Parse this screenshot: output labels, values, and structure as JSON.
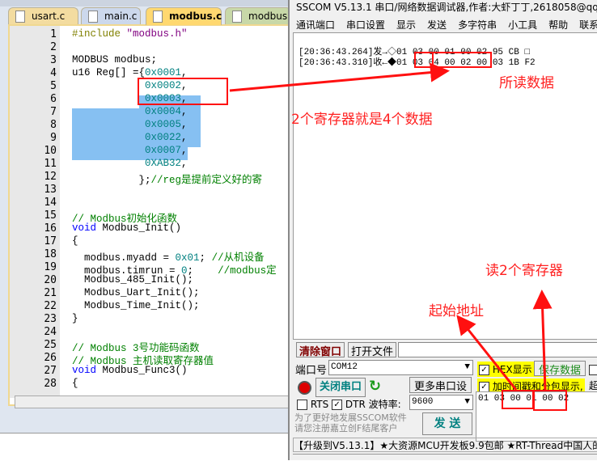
{
  "editor": {
    "tabs": [
      "usart.c",
      "main.c",
      "modbus.c",
      "modbus.h"
    ],
    "active_tab": "modbus.c",
    "line_numbers": [
      1,
      2,
      3,
      4,
      5,
      6,
      7,
      8,
      9,
      10,
      11,
      12,
      13,
      14,
      15,
      16,
      17,
      18,
      19,
      20,
      21,
      22,
      23,
      24,
      25,
      26,
      27,
      28
    ],
    "lines": [
      [
        [
          "#include ",
          "pp"
        ],
        [
          "\"modbus.h\"",
          "str"
        ]
      ],
      [],
      [
        [
          "MODBUS modbus;",
          ""
        ]
      ],
      [
        [
          "u16 Reg[] ={",
          ""
        ],
        [
          "0x0001",
          "num"
        ],
        [
          ",",
          ""
        ]
      ],
      [
        [
          "            ",
          ""
        ],
        [
          "0x0002",
          "num"
        ],
        [
          ",",
          ""
        ]
      ],
      [
        [
          "            ",
          ""
        ],
        [
          "0x0003",
          "num"
        ],
        [
          ",",
          ""
        ]
      ],
      [
        [
          "            ",
          ""
        ],
        [
          "0x0004",
          "num"
        ],
        [
          ",",
          ""
        ]
      ],
      [
        [
          "            ",
          ""
        ],
        [
          "0x0005",
          "num"
        ],
        [
          ",",
          ""
        ]
      ],
      [
        [
          "            ",
          ""
        ],
        [
          "0x0022",
          "num"
        ],
        [
          ",",
          ""
        ]
      ],
      [
        [
          "            ",
          ""
        ],
        [
          "0x0007",
          "num"
        ],
        [
          ",",
          ""
        ]
      ],
      [
        [
          "            ",
          ""
        ],
        [
          "0XAB32",
          "num"
        ],
        [
          ",",
          ""
        ]
      ],
      [
        [
          "           };",
          ""
        ],
        [
          "//reg是提前定义好的寄",
          "cm"
        ]
      ],
      [],
      [],
      [
        [
          "// Modbus初始化函数",
          "cm"
        ]
      ],
      [
        [
          "void",
          "kw"
        ],
        [
          " Modbus_Init()",
          ""
        ]
      ],
      [
        [
          "{",
          ""
        ]
      ],
      [
        [
          "  modbus.myadd = ",
          ""
        ],
        [
          "0x01",
          "num"
        ],
        [
          "; ",
          ""
        ],
        [
          "//从机设备",
          "cm"
        ]
      ],
      [
        [
          "  modbus.timrun = ",
          ""
        ],
        [
          "0",
          "num"
        ],
        [
          ";    ",
          ""
        ],
        [
          "//modbus定",
          "cm"
        ]
      ],
      [
        [
          "  Modbus_485_Init();",
          ""
        ]
      ],
      [
        [
          "  Modbus_Uart_Init();",
          ""
        ]
      ],
      [
        [
          "  Modbus_Time_Init();",
          ""
        ]
      ],
      [
        [
          "}",
          ""
        ]
      ],
      [],
      [
        [
          "// Modbus 3号功能码函数",
          "cm"
        ]
      ],
      [
        [
          "// Modbus 主机读取寄存器值",
          "cm"
        ]
      ],
      [
        [
          "void",
          "kw"
        ],
        [
          " Modbus_Func3()",
          ""
        ]
      ],
      [
        [
          "{",
          ""
        ]
      ]
    ]
  },
  "sscom": {
    "title": "SSCOM V5.13.1 串口/网络数据调试器,作者:大虾丁丁,2618058@qq",
    "menu": [
      "通讯端口",
      "串口设置",
      "显示",
      "发送",
      "多字符串",
      "小工具",
      "帮助",
      "联系"
    ],
    "recv_lines": [
      "[20:36:43.264]发→◇01 03 00 01 00 02 95 CB □",
      "[20:36:43.310]收←◆01 03 04 00 02 00 03 1B F2"
    ],
    "clear_btn": "清除窗口",
    "open_file_btn": "打开文件",
    "port_label": "端口号",
    "port_value": "COM12",
    "close_port_btn": "关闭串口",
    "more_settings_btn": "更多串口设置",
    "rts": "RTS",
    "dtr": "DTR",
    "baud_label": "波特率:",
    "baud_value": "9600",
    "hex_display": "HEX显示",
    "save_data": "保存数据",
    "timestamp": "加时间戳和分包显示,",
    "timeout": "超",
    "send_text": "01 03 00 01 00 02",
    "promo": "为了更好地发展SSCOM软件\n请您注册嘉立创F结尾客户",
    "send_btn": "发  送",
    "ticker": "【升级到V5.13.1】★大资源MCU开发板9.9包邮 ★RT-Thread中国人的开"
  },
  "annotations": {
    "read_data": "所读数据",
    "two_regs": "2个寄存器就是4个数据",
    "read_two": "读2个寄存器",
    "start_addr": "起始地址"
  }
}
